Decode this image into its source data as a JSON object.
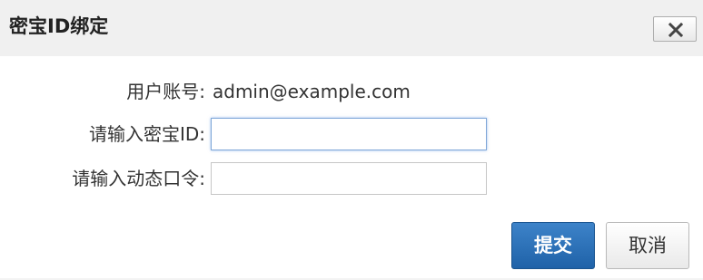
{
  "dialog": {
    "title": "密宝ID绑定",
    "close_icon": "close-icon",
    "close_symbol": "X"
  },
  "form": {
    "account": {
      "label": "用户账号:",
      "value": "admin@example.com"
    },
    "token_id": {
      "label": "请输入密宝ID:",
      "value": "",
      "placeholder": ""
    },
    "dynamic_code": {
      "label": "请输入动态口令:",
      "value": "",
      "placeholder": ""
    }
  },
  "actions": {
    "submit_label": "提交",
    "cancel_label": "取消"
  },
  "colors": {
    "primary_button": "#2a6fb8",
    "titlebar": "#f0f0f0",
    "focus_border": "#7fa7d8"
  }
}
